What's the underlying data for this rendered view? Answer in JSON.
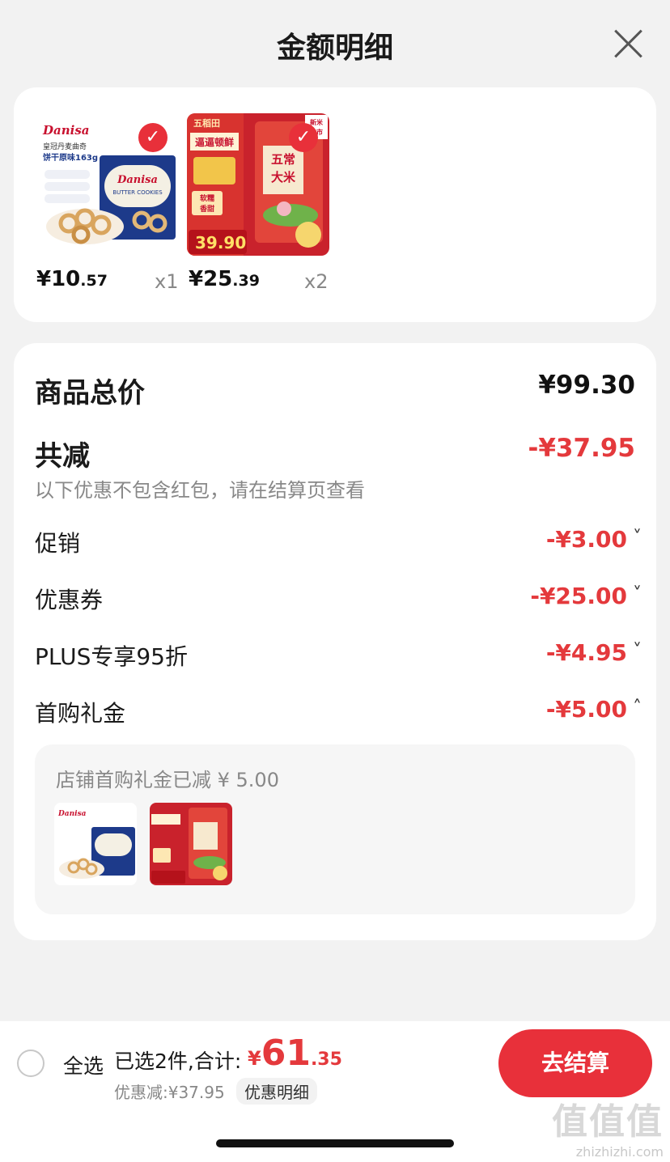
{
  "header": {
    "title": "金额明细"
  },
  "products": [
    {
      "price_int": "¥10",
      "price_dec": ".57",
      "qty": "x1",
      "brand": "Danisa",
      "desc": "皇冠丹麦曲奇 饼干原味163g",
      "pkg": "BUTTER COOKIES"
    },
    {
      "price_int": "¥25",
      "price_dec": ".39",
      "qty": "x2",
      "brand": "五稻田",
      "slogan": "逼逼顿鲜",
      "tag": "软糯香甜",
      "product_name": "五常大米",
      "badge": "新米上市",
      "promo": "39.90"
    }
  ],
  "summary": {
    "total_label": "商品总价",
    "total_value": "¥99.30",
    "reduce_label": "共减",
    "reduce_value": "-¥37.95",
    "note": "以下优惠不包含红包，请在结算页查看",
    "items": [
      {
        "label": "促销",
        "value": "-¥3.00",
        "chevron": "˅"
      },
      {
        "label": "优惠券",
        "value": "-¥25.00",
        "chevron": "˅"
      },
      {
        "label": "PLUS专享95折",
        "value": "-¥4.95",
        "chevron": "˅"
      },
      {
        "label": "首购礼金",
        "value": "-¥5.00",
        "chevron": "˄"
      }
    ],
    "gift_text": "店铺首购礼金已减 ¥ 5.00"
  },
  "bottom": {
    "select_all": "全选",
    "selected_text": "已选2件,合计:",
    "total_cur": "¥",
    "total_int": "61",
    "total_dec": ".35",
    "discount_text": "优惠减:¥37.95",
    "detail_chip": "优惠明细",
    "checkout": "去结算"
  },
  "watermark": {
    "logo": "值值值",
    "url": "zhizhizhi.com"
  },
  "colors": {
    "accent": "#e4393c",
    "button": "#e8303a"
  }
}
